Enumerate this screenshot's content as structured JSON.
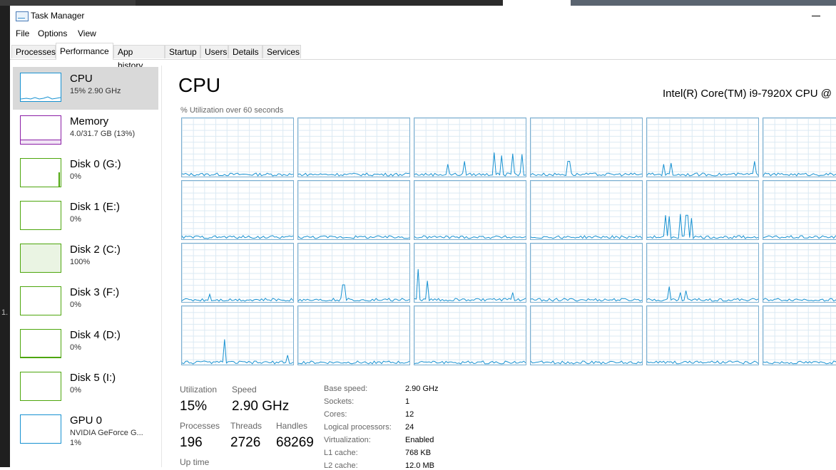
{
  "window": {
    "title": "Task Manager"
  },
  "menu": {
    "file": "File",
    "options": "Options",
    "view": "View"
  },
  "tabs": [
    "Processes",
    "Performance",
    "App history",
    "Startup",
    "Users",
    "Details",
    "Services"
  ],
  "sidebar": {
    "items": [
      {
        "name": "CPU",
        "sub": "15% 2.90 GHz",
        "color": "#1791d1"
      },
      {
        "name": "Memory",
        "sub": "4.0/31.7 GB (13%)",
        "color": "#8b1ea6"
      },
      {
        "name": "Disk 0 (G:)",
        "sub": "0%",
        "color": "#4da60c"
      },
      {
        "name": "Disk 1 (E:)",
        "sub": "0%",
        "color": "#4da60c"
      },
      {
        "name": "Disk 2 (C:)",
        "sub": "100%",
        "color": "#4da60c"
      },
      {
        "name": "Disk 3 (F:)",
        "sub": "0%",
        "color": "#4da60c"
      },
      {
        "name": "Disk 4 (D:)",
        "sub": "0%",
        "color": "#4da60c"
      },
      {
        "name": "Disk 5 (I:)",
        "sub": "0%",
        "color": "#4da60c"
      },
      {
        "name": "GPU 0",
        "sub": "NVIDIA GeForce G...",
        "sub2": "1%",
        "color": "#1791d1"
      }
    ]
  },
  "main": {
    "title": "CPU",
    "cpu_name": "Intel(R) Core(TM) i9-7920X CPU @",
    "util_label": "% Utilization over 60 seconds",
    "line_color": "#1791d1"
  },
  "stats": {
    "utilization_label": "Utilization",
    "utilization": "15%",
    "speed_label": "Speed",
    "speed": "2.90 GHz",
    "processes_label": "Processes",
    "processes": "196",
    "threads_label": "Threads",
    "threads": "2726",
    "handles_label": "Handles",
    "handles": "68269",
    "uptime_label": "Up time"
  },
  "specs": [
    {
      "key": "Base speed:",
      "value": "2.90 GHz"
    },
    {
      "key": "Sockets:",
      "value": "1"
    },
    {
      "key": "Cores:",
      "value": "12"
    },
    {
      "key": "Logical processors:",
      "value": "24"
    },
    {
      "key": "Virtualization:",
      "value": "Enabled"
    },
    {
      "key": "L1 cache:",
      "value": "768 KB"
    },
    {
      "key": "L2 cache:",
      "value": "12.0 MB"
    }
  ]
}
